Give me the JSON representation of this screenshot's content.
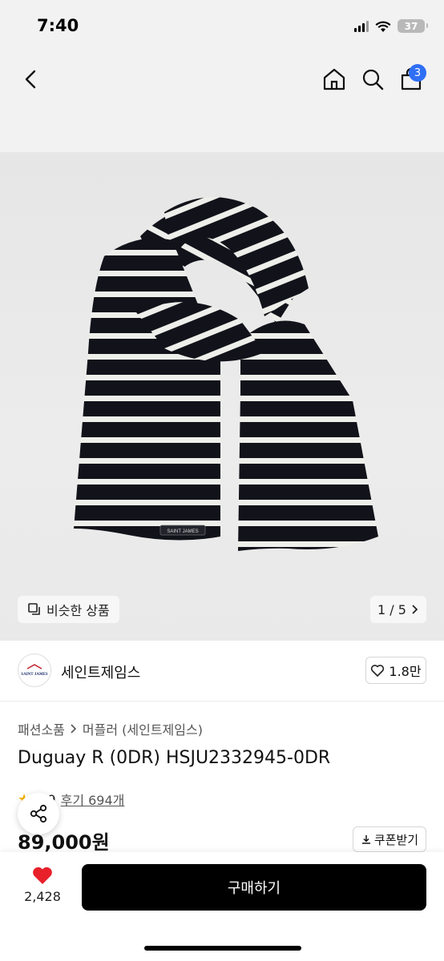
{
  "status": {
    "time": "7:40",
    "battery": "37"
  },
  "header": {
    "cart_count": "3"
  },
  "gallery": {
    "similar_label": "비슷한 상품",
    "pager": "1 / 5",
    "logo_text": "SAINT JAMES"
  },
  "brand": {
    "name": "세인트제임스",
    "likes": "1.8만",
    "logo_text": "SAINT JAMES"
  },
  "product": {
    "breadcrumb": [
      "패션소품",
      "머플러 (세인트제임스)"
    ],
    "title": "Duguay R (0DR) HSJU2332945-0DR",
    "rating": "4.9",
    "reviews": "후기 694개",
    "price": "89,000원",
    "coupon_label": "쿠폰받기"
  },
  "bottom": {
    "wish_count": "2,428",
    "buy_label": "구매하기"
  },
  "colors": {
    "accent": "#2f6ff6",
    "heart": "#e8202a",
    "buy_button": "#000000",
    "star": "#f5b400"
  },
  "icons": [
    "back-icon",
    "home-icon",
    "search-icon",
    "shopping-bag-icon",
    "similar-icon",
    "chevron-right-icon",
    "heart-outline-icon",
    "chevron-right-small-icon",
    "star-icon",
    "share-icon",
    "download-icon",
    "heart-filled-icon"
  ]
}
